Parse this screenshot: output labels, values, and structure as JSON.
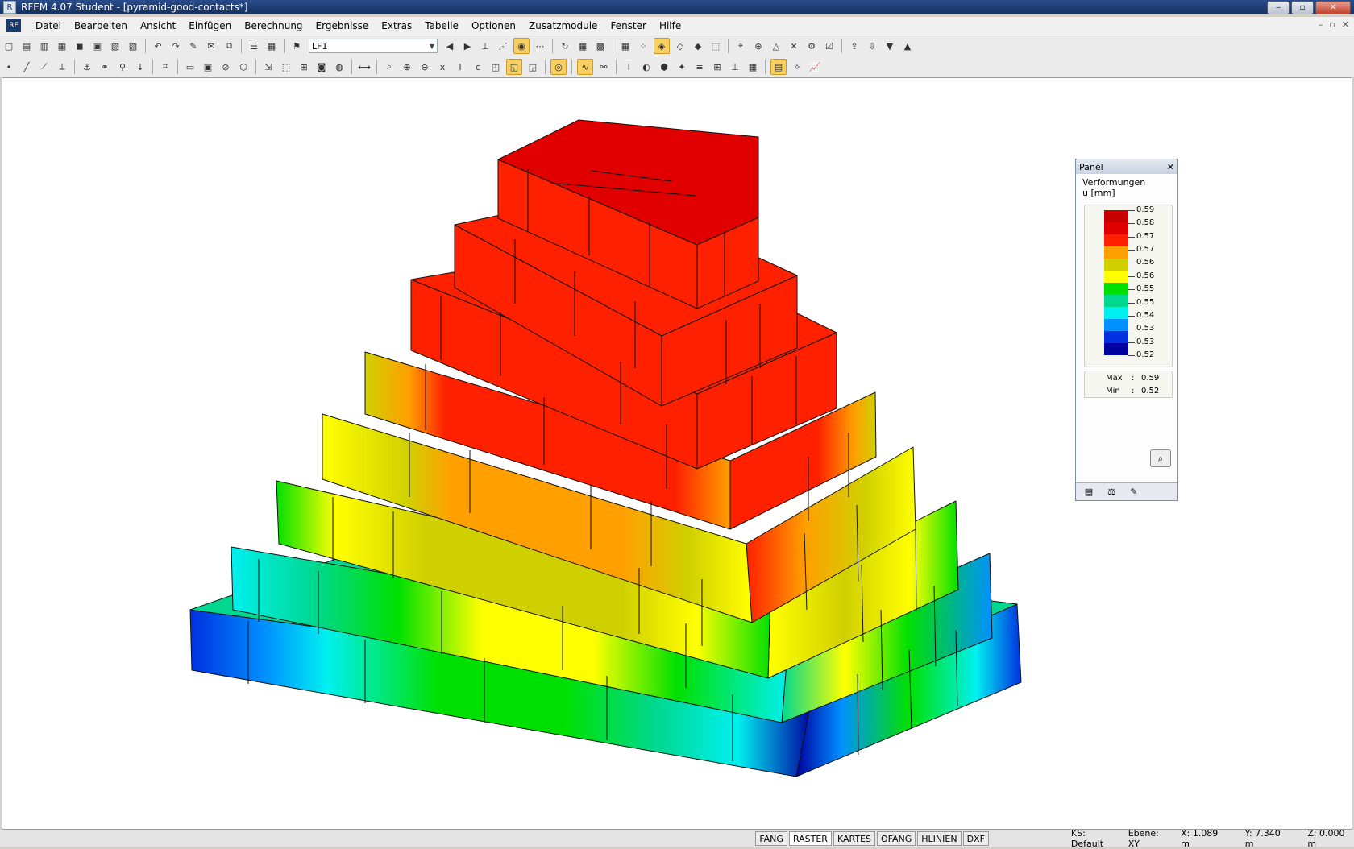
{
  "window": {
    "title": "RFEM 4.07 Student - [pyramid-good-contacts*]"
  },
  "menu": [
    "Datei",
    "Bearbeiten",
    "Ansicht",
    "Einfügen",
    "Berechnung",
    "Ergebnisse",
    "Extras",
    "Tabelle",
    "Optionen",
    "Zusatzmodule",
    "Fenster",
    "Hilfe"
  ],
  "toolbar": {
    "loadcase": "LF1"
  },
  "panel": {
    "title": "Panel",
    "caption_line1": "Verformungen",
    "caption_line2": "u [mm]",
    "legend_values": [
      "0.59",
      "0.58",
      "0.57",
      "0.57",
      "0.56",
      "0.56",
      "0.55",
      "0.55",
      "0.54",
      "0.53",
      "0.53",
      "0.52"
    ],
    "legend_colors": [
      "#c80000",
      "#e00000",
      "#ff2000",
      "#ffa000",
      "#d0d000",
      "#ffff00",
      "#00e000",
      "#00d890",
      "#00f0f0",
      "#0090ff",
      "#0030e0",
      "#0000a0"
    ],
    "max_label": "Max",
    "max_value": "0.59",
    "min_label": "Min",
    "min_value": "0.52"
  },
  "status": {
    "buttons": [
      "FANG",
      "RASTER",
      "KARTES",
      "OFANG",
      "HLINIEN",
      "DXF"
    ],
    "ks": "KS: Default",
    "ebene": "Ebene: XY",
    "x": "X:  1.089 m",
    "y": "Y:  7.340 m",
    "z": "Z:  0.000 m"
  }
}
